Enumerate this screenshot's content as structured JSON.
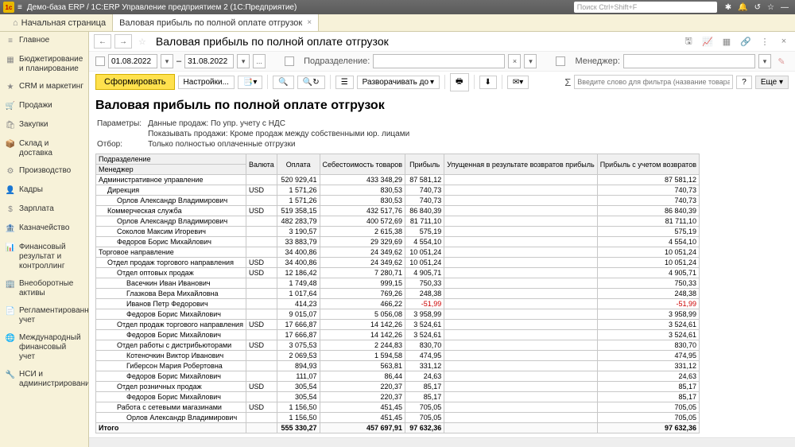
{
  "app": {
    "title": "Демо-база ERP / 1С:ERP Управление предприятием 2  (1С:Предприятие)",
    "search_placeholder": "Поиск Ctrl+Shift+F"
  },
  "tabs": [
    {
      "label": "Начальная страница",
      "active": false
    },
    {
      "label": "Валовая прибыль по полной оплате отгрузок",
      "active": true
    }
  ],
  "sidebar": [
    {
      "icon": "≡",
      "label": "Главное"
    },
    {
      "icon": "▦",
      "label": "Бюджетирование и планирование"
    },
    {
      "icon": "★",
      "label": "CRM и маркетинг"
    },
    {
      "icon": "🛒",
      "label": "Продажи"
    },
    {
      "icon": "🛍",
      "label": "Закупки"
    },
    {
      "icon": "📦",
      "label": "Склад и доставка"
    },
    {
      "icon": "⚙",
      "label": "Производство"
    },
    {
      "icon": "👤",
      "label": "Кадры"
    },
    {
      "icon": "$",
      "label": "Зарплата"
    },
    {
      "icon": "🏦",
      "label": "Казначейство"
    },
    {
      "icon": "📊",
      "label": "Финансовый результат и контроллинг"
    },
    {
      "icon": "🏢",
      "label": "Внеоборотные активы"
    },
    {
      "icon": "📄",
      "label": "Регламентированный учет"
    },
    {
      "icon": "🌐",
      "label": "Международный финансовый учет"
    },
    {
      "icon": "🔧",
      "label": "НСИ и администрирование"
    }
  ],
  "page": {
    "title": "Валовая прибыль по полной оплате отгрузок",
    "filters": {
      "date_from": "01.08.2022",
      "date_to": "31.08.2022",
      "dash": "–",
      "ellipsis": "...",
      "dept_label": "Подразделение:",
      "mgr_label": "Менеджер:"
    },
    "toolbar": {
      "form": "Сформировать",
      "settings": "Настройки...",
      "expand": "Разворачивать до",
      "filter_placeholder": "Введите слово для фильтра (название товара, покупателя и т.",
      "more": "Еще"
    },
    "report": {
      "heading": "Валовая прибыль по полной оплате отгрузок",
      "param_label": "Параметры:",
      "param1": "Данные продаж: По упр. учету с НДС",
      "param2": "Показывать продажи: Кроме продаж между собственными юр. лицами",
      "sel_label": "Отбор:",
      "sel1": "Только полностью оплаченные отгрузки",
      "headers": {
        "dept": "Подразделение",
        "manager": "Менеджер",
        "currency": "Валюта",
        "payment": "Оплата",
        "cost": "Себестоимость товаров",
        "profit": "Прибыль",
        "lost": "Упущенная в результате возвратов прибыль",
        "profit_ret": "Прибыль с учетом возвратов"
      },
      "rows": [
        {
          "lvl": 0,
          "name": "Административное управление",
          "cur": "",
          "pay": "520 929,41",
          "cost": "433 348,29",
          "prof": "87 581,12",
          "lost": "",
          "pret": "87 581,12"
        },
        {
          "lvl": 1,
          "name": "Дирекция",
          "cur": "USD",
          "pay": "1 571,26",
          "cost": "830,53",
          "prof": "740,73",
          "lost": "",
          "pret": "740,73"
        },
        {
          "lvl": 2,
          "name": "Орлов Александр Владимирович",
          "cur": "",
          "pay": "1 571,26",
          "cost": "830,53",
          "prof": "740,73",
          "lost": "",
          "pret": "740,73"
        },
        {
          "lvl": 1,
          "name": "Коммерческая служба",
          "cur": "USD",
          "pay": "519 358,15",
          "cost": "432 517,76",
          "prof": "86 840,39",
          "lost": "",
          "pret": "86 840,39"
        },
        {
          "lvl": 2,
          "name": "Орлов Александр Владимирович",
          "cur": "",
          "pay": "482 283,79",
          "cost": "400 572,69",
          "prof": "81 711,10",
          "lost": "",
          "pret": "81 711,10"
        },
        {
          "lvl": 2,
          "name": "Соколов Максим Игоревич",
          "cur": "",
          "pay": "3 190,57",
          "cost": "2 615,38",
          "prof": "575,19",
          "lost": "",
          "pret": "575,19"
        },
        {
          "lvl": 2,
          "name": "Федоров Борис Михайлович",
          "cur": "",
          "pay": "33 883,79",
          "cost": "29 329,69",
          "prof": "4 554,10",
          "lost": "",
          "pret": "4 554,10"
        },
        {
          "lvl": 0,
          "name": "Торговое направление",
          "cur": "",
          "pay": "34 400,86",
          "cost": "24 349,62",
          "prof": "10 051,24",
          "lost": "",
          "pret": "10 051,24"
        },
        {
          "lvl": 1,
          "name": "Отдел продаж торгового направления",
          "cur": "USD",
          "pay": "34 400,86",
          "cost": "24 349,62",
          "prof": "10 051,24",
          "lost": "",
          "pret": "10 051,24"
        },
        {
          "lvl": 2,
          "name": "Отдел оптовых продаж",
          "cur": "USD",
          "pay": "12 186,42",
          "cost": "7 280,71",
          "prof": "4 905,71",
          "lost": "",
          "pret": "4 905,71"
        },
        {
          "lvl": 3,
          "name": "Васечкин Иван Иванович",
          "cur": "",
          "pay": "1 749,48",
          "cost": "999,15",
          "prof": "750,33",
          "lost": "",
          "pret": "750,33"
        },
        {
          "lvl": 3,
          "name": "Глазкова Вера Михайловна",
          "cur": "",
          "pay": "1 017,64",
          "cost": "769,26",
          "prof": "248,38",
          "lost": "",
          "pret": "248,38"
        },
        {
          "lvl": 3,
          "name": "Иванов Петр Федорович",
          "cur": "",
          "pay": "414,23",
          "cost": "466,22",
          "prof": "-51,99",
          "lost": "",
          "pret": "-51,99",
          "neg": true
        },
        {
          "lvl": 3,
          "name": "Федоров Борис Михайлович",
          "cur": "",
          "pay": "9 015,07",
          "cost": "5 056,08",
          "prof": "3 958,99",
          "lost": "",
          "pret": "3 958,99"
        },
        {
          "lvl": 2,
          "name": "Отдел продаж торгового направления",
          "cur": "USD",
          "pay": "17 666,87",
          "cost": "14 142,26",
          "prof": "3 524,61",
          "lost": "",
          "pret": "3 524,61"
        },
        {
          "lvl": 3,
          "name": "Федоров Борис Михайлович",
          "cur": "",
          "pay": "17 666,87",
          "cost": "14 142,26",
          "prof": "3 524,61",
          "lost": "",
          "pret": "3 524,61"
        },
        {
          "lvl": 2,
          "name": "Отдел работы с дистрибьюторами",
          "cur": "USD",
          "pay": "3 075,53",
          "cost": "2 244,83",
          "prof": "830,70",
          "lost": "",
          "pret": "830,70"
        },
        {
          "lvl": 3,
          "name": "Котеночкин Виктор Иванович",
          "cur": "",
          "pay": "2 069,53",
          "cost": "1 594,58",
          "prof": "474,95",
          "lost": "",
          "pret": "474,95"
        },
        {
          "lvl": 3,
          "name": "Гиберсон Мария Робертовна",
          "cur": "",
          "pay": "894,93",
          "cost": "563,81",
          "prof": "331,12",
          "lost": "",
          "pret": "331,12"
        },
        {
          "lvl": 3,
          "name": "Федоров Борис Михайлович",
          "cur": "",
          "pay": "111,07",
          "cost": "86,44",
          "prof": "24,63",
          "lost": "",
          "pret": "24,63"
        },
        {
          "lvl": 2,
          "name": "Отдел розничных продаж",
          "cur": "USD",
          "pay": "305,54",
          "cost": "220,37",
          "prof": "85,17",
          "lost": "",
          "pret": "85,17"
        },
        {
          "lvl": 3,
          "name": "Федоров Борис Михайлович",
          "cur": "",
          "pay": "305,54",
          "cost": "220,37",
          "prof": "85,17",
          "lost": "",
          "pret": "85,17"
        },
        {
          "lvl": 2,
          "name": "Работа с сетевыми магазинами",
          "cur": "USD",
          "pay": "1 156,50",
          "cost": "451,45",
          "prof": "705,05",
          "lost": "",
          "pret": "705,05"
        },
        {
          "lvl": 3,
          "name": "Орлов Александр Владимирович",
          "cur": "",
          "pay": "1 156,50",
          "cost": "451,45",
          "prof": "705,05",
          "lost": "",
          "pret": "705,05"
        }
      ],
      "total_label": "Итого",
      "total": {
        "pay": "555 330,27",
        "cost": "457 697,91",
        "prof": "97 632,36",
        "lost": "",
        "pret": "97 632,36"
      }
    }
  }
}
